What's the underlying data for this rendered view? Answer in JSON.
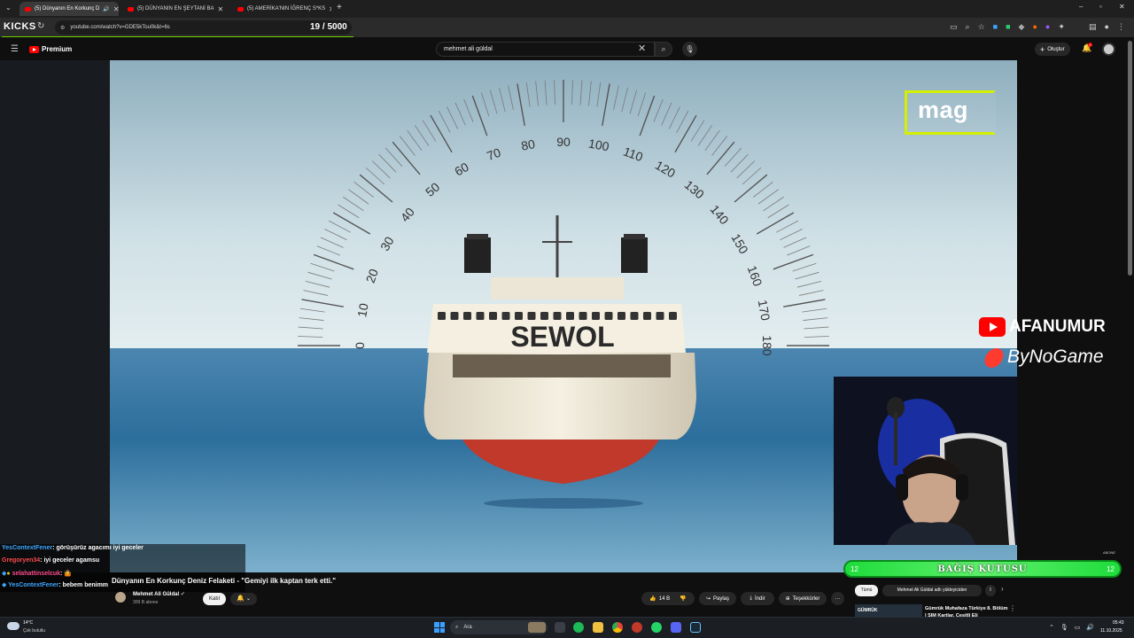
{
  "tabs": [
    {
      "title": "(5) Dünyanın En Korkunç D",
      "active": true
    },
    {
      "title": "(5) DÜNYANIN EN ŞEYTANİ BA"
    },
    {
      "title": "(5) AMERİKA'NIN İĞRENÇ S*KS"
    }
  ],
  "toolbar": {
    "brand": "KICKS",
    "url": "youtube.com/watch?v=GDE5kTou0k&t=6s",
    "counter": "19 / 5000"
  },
  "youtube": {
    "logo_text": "Premium",
    "search_value": "mehmet ali güldal",
    "create_label": "Oluştur",
    "notif_count": "9"
  },
  "video": {
    "speedometer": {
      "labels": [
        "0",
        "10",
        "20",
        "30",
        "40",
        "50",
        "60",
        "70",
        "80",
        "90",
        "100",
        "110",
        "120",
        "130",
        "140",
        "150",
        "160",
        "170",
        "180"
      ]
    },
    "ship_name": "SEWOL",
    "mag_label": "mag",
    "watermark_youtube": "AFANUMUR",
    "watermark_sponsor": "ByNoGame"
  },
  "donation": {
    "label": "BAĞIŞ KUTUSU",
    "left_num": "12",
    "right_num": "12",
    "abone": "ABONE"
  },
  "chat": [
    {
      "name": "YesContextFener",
      "msg": ": görüşürüz agacımı iyi geceler",
      "color": "#3ea6ff"
    },
    {
      "name": "Gregoryen34",
      "msg": ": iyi geceler agamsu",
      "color": "#ff4b4b"
    },
    {
      "name": "selahattinselcuk",
      "msg": ": 🤷",
      "color": "#ff4b8a"
    },
    {
      "name": "YesContextFener",
      "msg": ": bebem benimm",
      "color": "#3ea6ff"
    }
  ],
  "below": {
    "title": "Dünyanın En Korkunç Deniz Felaketi - \"Gemiyi ilk kaptan terk etti.\"",
    "channel": "Mehmet Ali Güldal",
    "subs": "309 B abone",
    "join": "Katıl",
    "likes": "14 B",
    "share": "Paylaş",
    "download": "İndir",
    "thanks": "Teşekkürler",
    "more": "···"
  },
  "recommendations": {
    "chips": [
      "Tümü",
      "Mehmet Ali Güldal adlı yükleyiciden",
      "İl"
    ],
    "first_title": "Gümrük Muhafaza Türkiye 8. Bölüm | SIM Kartlar, Çeşitli Eli",
    "thumb_label": "GÜMRÜK"
  },
  "taskbar": {
    "temp": "14°C",
    "weather": "Çok bulutlu",
    "search": "Ara",
    "time": "05:43",
    "date": "11.10.2025"
  }
}
